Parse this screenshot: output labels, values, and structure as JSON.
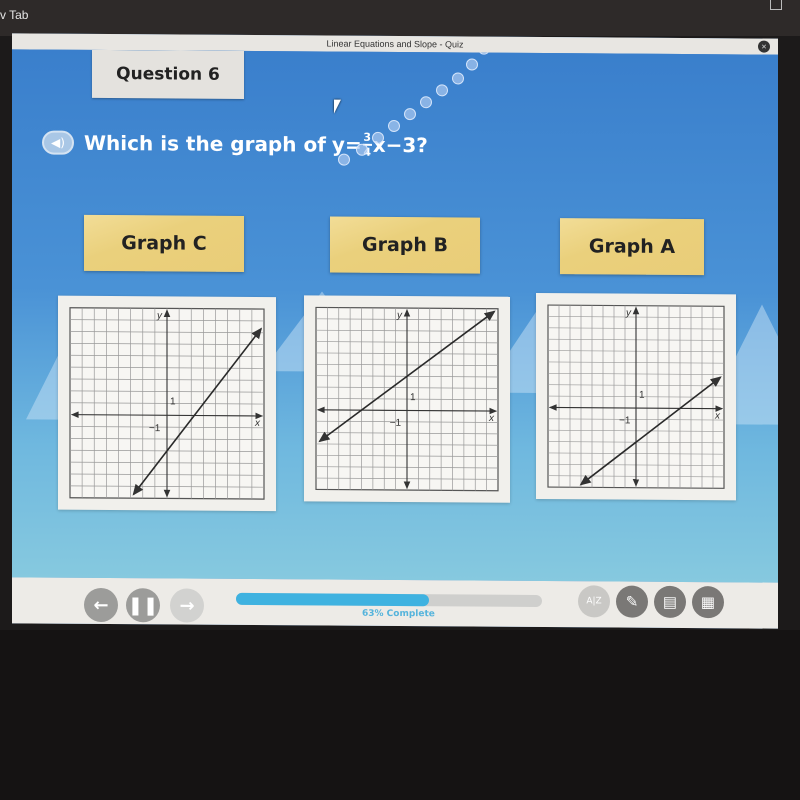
{
  "browser": {
    "tab_label": "v Tab"
  },
  "window": {
    "title": "Linear Equations and Slope - Quiz",
    "close_icon": "close-icon"
  },
  "question": {
    "number_label": "Question 6",
    "audio_icon": "speaker-icon",
    "prompt_prefix": "Which is the graph of ",
    "equation_lhs": "y=",
    "fraction_numerator": "3",
    "fraction_denominator": "4",
    "equation_rhs": "x−3",
    "prompt_suffix": " ?"
  },
  "choices": [
    {
      "label": "Graph C",
      "x_axis_label": "x",
      "y_axis_label": "y",
      "tick_positive": "1",
      "tick_negative": "−1",
      "line": {
        "slope": 1.333,
        "intercept": -3
      }
    },
    {
      "label": "Graph B",
      "x_axis_label": "x",
      "y_axis_label": "y",
      "tick_positive": "1",
      "tick_negative": "−1",
      "line": {
        "slope": 0.75,
        "intercept": 3
      }
    },
    {
      "label": "Graph A",
      "x_axis_label": "x",
      "y_axis_label": "y",
      "tick_positive": "1",
      "tick_negative": "−1",
      "line": {
        "slope": 0.75,
        "intercept": -3
      }
    }
  ],
  "grid": {
    "x_range": [
      -8,
      8
    ],
    "y_range": [
      -7,
      9
    ]
  },
  "toolbar": {
    "back_icon": "arrow-left-icon",
    "pause_icon": "pause-icon",
    "forward_icon": "arrow-right-icon",
    "progress_percent": 63,
    "progress_label": "63% Complete",
    "glossary_label": "A|Z",
    "glossary_icon": "glossary-icon",
    "pencil_icon": "pencil-icon",
    "notepad_icon": "notepad-icon",
    "calculator_icon": "calculator-icon"
  },
  "colors": {
    "stage_blue": "#3d82cc",
    "choice_gold": "#ead07c",
    "progress_blue": "#3fb2e0",
    "tool_gray": "#7a7876"
  }
}
